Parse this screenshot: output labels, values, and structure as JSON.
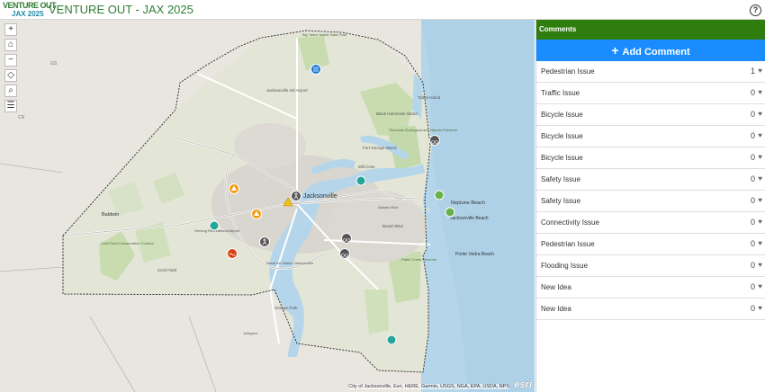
{
  "header": {
    "logo_line1": "VENTURE OUT",
    "logo_line2": "JAX 2025",
    "title": "VENTURE OUT - JAX 2025",
    "help_icon": "help-circle-icon"
  },
  "map": {
    "attribution": "City of Jacksonville, Esri, HERE, Garmin, USGS, NGA, EPA, USDA, NPS",
    "esri_logo": "esri",
    "labels": {
      "city": "Jacksonville",
      "baldwin": "Baldwin",
      "neptune": "Neptune Beach",
      "jax_beach": "Jacksonville Beach",
      "ponte": "Ponte Vedra Beach",
      "airport": "Jacksonville Intl Airport",
      "talbot": "Talbot Island",
      "black_hammock": "Black Hammock Island",
      "fort_george": "Fort George Island",
      "timucuan": "Timucuan Ecological and Historic Preserve",
      "mill_cove": "Mill Cove",
      "beach_blvd": "Beach Blvd",
      "cecil": "Cecil Field",
      "herlong": "Herlong Recreational Airport",
      "naval": "Naval Air Station Jacksonville",
      "orange_park": "Orange Park",
      "pablo": "Pablo Creek Preserve",
      "atlantic": "Atlantic Blvd",
      "state_gs": "GS",
      "state_cr": "CR",
      "big_talbot": "Big Talbot Island State Park",
      "cecil_conservation": "Cecil Field Conservation Corridor",
      "julington": "Julington"
    },
    "tools": [
      "zoom-in",
      "home",
      "zoom-out",
      "locate",
      "search",
      "layer-list"
    ],
    "tool_glyphs": [
      "+",
      "⌂",
      "−",
      "◇",
      "⌕",
      "☰"
    ]
  },
  "comments": {
    "panel_title": "Comments",
    "add_label": "Add Comment",
    "rows": [
      {
        "label": "Pedestrian Issue",
        "count": "1"
      },
      {
        "label": "Traffic Issue",
        "count": "0"
      },
      {
        "label": "Bicycle Issue",
        "count": "0"
      },
      {
        "label": "Bicycle Issue",
        "count": "0"
      },
      {
        "label": "Bicycle Issue",
        "count": "0"
      },
      {
        "label": "Safety Issue",
        "count": "0"
      },
      {
        "label": "Safety Issue",
        "count": "0"
      },
      {
        "label": "Connectivity Issue",
        "count": "0"
      },
      {
        "label": "Pedestrian Issue",
        "count": "0"
      },
      {
        "label": "Flooding Issue",
        "count": "0"
      },
      {
        "label": "New Idea",
        "count": "0"
      },
      {
        "label": "New Idea",
        "count": "0"
      }
    ],
    "heart_glyph": "♥"
  },
  "colors": {
    "brand_green": "#2e7d0e",
    "accent_blue": "#1a8cff",
    "water": "#b5d6ea",
    "park": "#c8dcb0"
  }
}
